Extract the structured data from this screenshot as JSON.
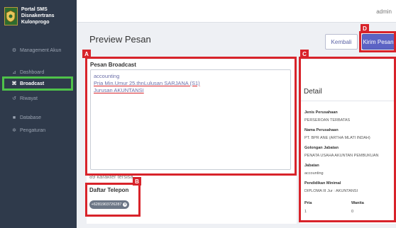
{
  "sidebar": {
    "brand": {
      "line1": "Portal SMS Disnakertrans",
      "line2": "Kulonprogo"
    },
    "items": [
      {
        "label": "Management Akun",
        "icon": "users-icon",
        "glyph": "⚙"
      },
      {
        "label": "Dashboard",
        "icon": "chart-icon",
        "glyph": "⊿"
      },
      {
        "label": "Broadcast",
        "icon": "broadcast-icon",
        "glyph": "⌘"
      },
      {
        "label": "Riwayat",
        "icon": "history-icon",
        "glyph": "↺"
      },
      {
        "label": "Database",
        "icon": "database-icon",
        "glyph": "■"
      },
      {
        "label": "Pengaturan",
        "icon": "gear-icon",
        "glyph": "✲"
      }
    ]
  },
  "topbar": {
    "user": "admin"
  },
  "page": {
    "title": "Preview Pesan",
    "back_label": "Kembali",
    "send_label": "Kirim Pesan"
  },
  "message": {
    "label": "Pesan Broadcast",
    "lines": [
      "accounting",
      "Pria Min.Umur 25.thnLulusan SARJANA (S1)",
      "Jurusan AKUNTANSI"
    ],
    "char_count": "89 karakter tersisa"
  },
  "phones": {
    "label": "Daftar Telepon",
    "items": [
      "+6281903726287"
    ]
  },
  "detail": {
    "title": "Detail",
    "fields": [
      {
        "label": "Jenis Perusahaan",
        "value": "PERSEROAN TERBATAS"
      },
      {
        "label": "Nama Perusahaan",
        "value": "PT. BPR ANE (ARTHA MLATI INDAH)"
      },
      {
        "label": "Golongan Jabatan",
        "value": "PENATA USAHA AKUNTAN PEMBUKUAN"
      },
      {
        "label": "Jabatan",
        "value": "accounting"
      },
      {
        "label": "Pendidikan Minimal",
        "value": "DIPLOMA III Jur : AKUNTANSI"
      }
    ],
    "pria_label": "Pria",
    "pria_value": "1",
    "wanita_label": "Wanita",
    "wanita_value": "0"
  },
  "annotations": {
    "a": "A",
    "b": "B",
    "c": "C",
    "d": "D"
  },
  "colors": {
    "sidebar": "#2f3a4b",
    "accent": "#5b63c4",
    "highlight_red": "#d8232a",
    "highlight_green": "#4fc24a"
  }
}
